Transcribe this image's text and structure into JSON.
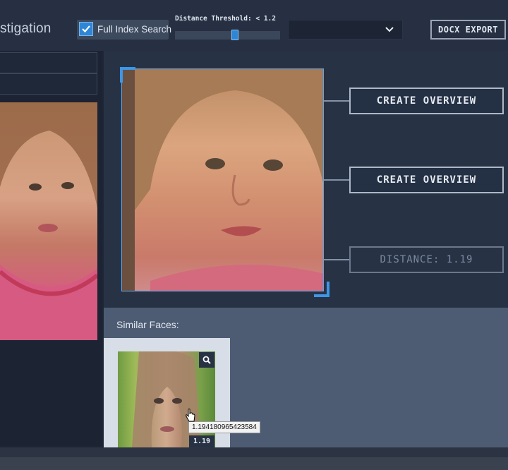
{
  "app": {
    "title_partial": "stigation"
  },
  "toolbar": {
    "full_index_search": {
      "label": "Full Index Search",
      "checked": true
    },
    "distance_threshold": {
      "label": "Distance Threshold: < 1.2",
      "value": 1.2
    },
    "select": {
      "value": ""
    },
    "export_label": "DOCX EXPORT"
  },
  "actions": {
    "create_overview_1": "CREATE OVERVIEW",
    "create_overview_2": "CREATE OVERVIEW",
    "distance": "DISTANCE: 1.19"
  },
  "similar": {
    "heading": "Similar Faces:",
    "items": [
      {
        "score": "1.19",
        "tooltip": "1.194180965423584"
      }
    ]
  },
  "colors": {
    "accent": "#2f86d6",
    "panel": "#283245",
    "background": "#1e2636"
  }
}
